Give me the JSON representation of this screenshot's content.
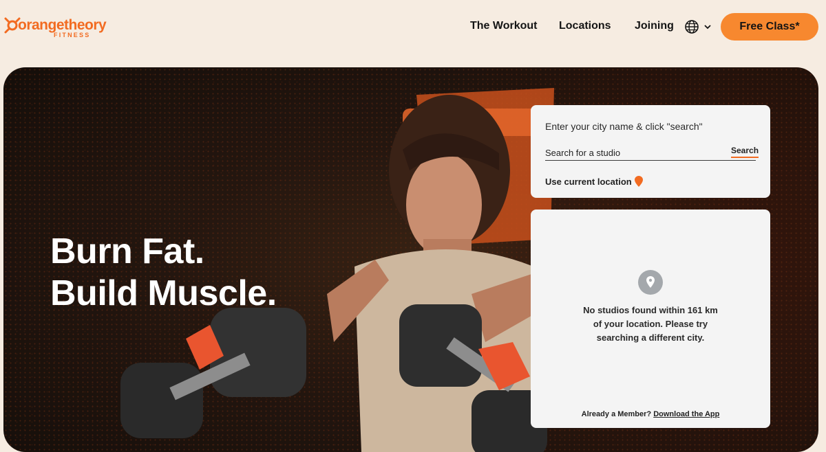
{
  "brand": {
    "name": "orangetheory",
    "sub": "FITNESS",
    "color": "#f26b21"
  },
  "nav": {
    "items": [
      {
        "label": "The Workout"
      },
      {
        "label": "Locations"
      },
      {
        "label": "Joining"
      }
    ],
    "language_icon": "globe-icon",
    "cta_label": "Free Class*",
    "cta_color": "#f7882f"
  },
  "hero": {
    "title_line1": "Burn Fat.",
    "title_line2": "Build Muscle."
  },
  "search": {
    "prompt": "Enter your city name & click \"search\"",
    "placeholder": "Search for a studio",
    "value": "",
    "button_label": "Search",
    "use_location_label": "Use current location"
  },
  "results": {
    "empty_message": "No studios found within 161 km of your location. Please try searching a different city.",
    "member_prompt": "Already a Member?",
    "download_link": "Download the App"
  }
}
